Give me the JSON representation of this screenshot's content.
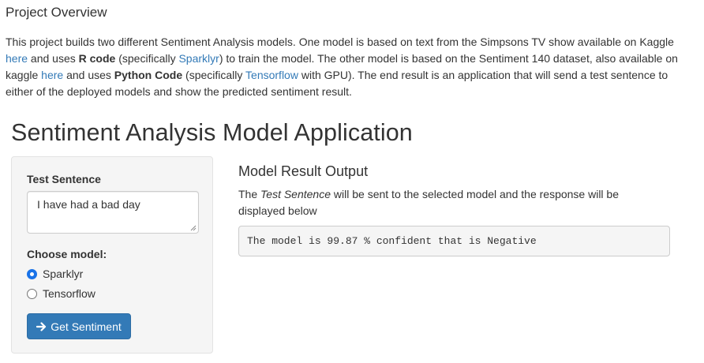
{
  "overview": {
    "title": "Project Overview",
    "p1": "This project builds two different Sentiment Analysis models. One model is based on text from the Simpsons TV show available on Kaggle ",
    "link1": "here",
    "p2": " and uses ",
    "bold1": "R code",
    "p3": " (specifically ",
    "link2": "Sparklyr",
    "p4": ") to train the model. The other model is based on the Sentiment 140 dataset, also available on kaggle ",
    "link3": "here",
    "p5": " and uses ",
    "bold2": "Python Code",
    "p6": " (specifically ",
    "link4": "Tensorflow",
    "p7": " with GPU). The end result is an application that will send a test sentence to either of the deployed models and show the predicted sentiment result."
  },
  "app": {
    "title": "Sentiment Analysis Model Application"
  },
  "sidebar": {
    "test_sentence_label": "Test Sentence",
    "test_sentence_value": "I have had a bad day",
    "choose_model_label": "Choose model:",
    "models": [
      {
        "label": "Sparklyr",
        "checked": true
      },
      {
        "label": "Tensorflow",
        "checked": false
      }
    ],
    "button_label": "Get Sentiment",
    "button_icon": "arrow-right-icon"
  },
  "result": {
    "title": "Model Result Output",
    "desc_pre": "The ",
    "desc_em": "Test Sentence",
    "desc_post": " will be sent to the selected model and the response will be displayed below",
    "output": "The model is 99.87 % confident that is Negative"
  },
  "colors": {
    "link": "#337ab7",
    "button_bg": "#337ab7",
    "panel_bg": "#f5f5f5",
    "radio_checked": "#1a73e8"
  }
}
